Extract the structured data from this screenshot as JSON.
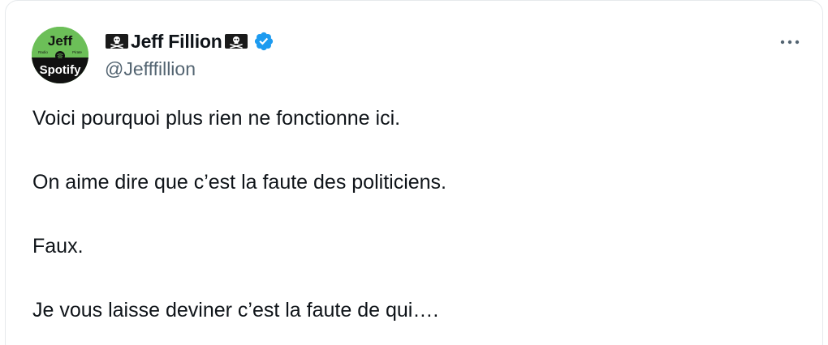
{
  "tweet": {
    "author": {
      "display_name": "Jeff Fillion",
      "handle": "@Jefffillion",
      "verified": true,
      "name_prefix_icon": "pirate-flag-icon",
      "name_suffix_icon": "pirate-flag-icon",
      "avatar": {
        "line1": "Jeff",
        "line2": "Spotify",
        "small_text_left": "Radio",
        "small_text_right": "Pirate"
      }
    },
    "more_icon": "more-options-icon",
    "lines": [
      "Voici pourquoi plus rien ne fonctionne ici.",
      "On aime dire que c’est la faute des politiciens.",
      "Faux.",
      "Je vous laisse deviner c’est la faute de qui…."
    ]
  },
  "colors": {
    "verified_badge": "#1d9bf0",
    "avatar_green": "#6cbf58",
    "secondary_text": "#536471"
  }
}
